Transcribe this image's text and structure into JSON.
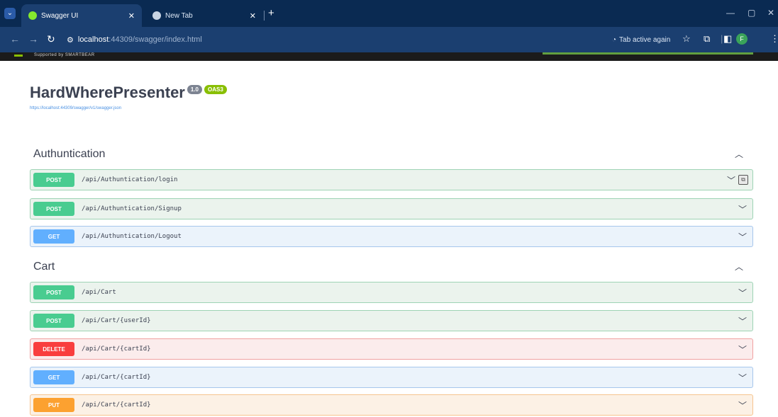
{
  "browser": {
    "tabs": [
      {
        "title": "Swagger UI",
        "active": true
      },
      {
        "title": "New Tab",
        "active": false
      }
    ],
    "address": {
      "host": "localhost",
      "path": ":44309/swagger/index.html"
    },
    "tab_active_label": "Tab active again",
    "profile_initial": "F"
  },
  "topbar": {
    "logo_text": "Supported by SMARTBEAR"
  },
  "info": {
    "title": "HardWherePresenter",
    "version": "1.0",
    "oas": "OAS3",
    "url": "https://localhost:44309/swagger/v1/swagger.json"
  },
  "sections": [
    {
      "name": "Authuntication",
      "operations": [
        {
          "method": "POST",
          "path": "/api/Authuntication/login"
        },
        {
          "method": "POST",
          "path": "/api/Authuntication/Signup"
        },
        {
          "method": "GET",
          "path": "/api/Authuntication/Logout"
        }
      ]
    },
    {
      "name": "Cart",
      "operations": [
        {
          "method": "POST",
          "path": "/api/Cart"
        },
        {
          "method": "POST",
          "path": "/api/Cart/{userId}"
        },
        {
          "method": "DELETE",
          "path": "/api/Cart/{cartId}"
        },
        {
          "method": "GET",
          "path": "/api/Cart/{cartId}"
        },
        {
          "method": "PUT",
          "path": "/api/Cart/{cartId}"
        }
      ]
    }
  ],
  "colors": {
    "post": "#49cc90",
    "get": "#61affe",
    "delete": "#f93e3e",
    "put": "#fca130",
    "chrome": "#0a2a52"
  }
}
